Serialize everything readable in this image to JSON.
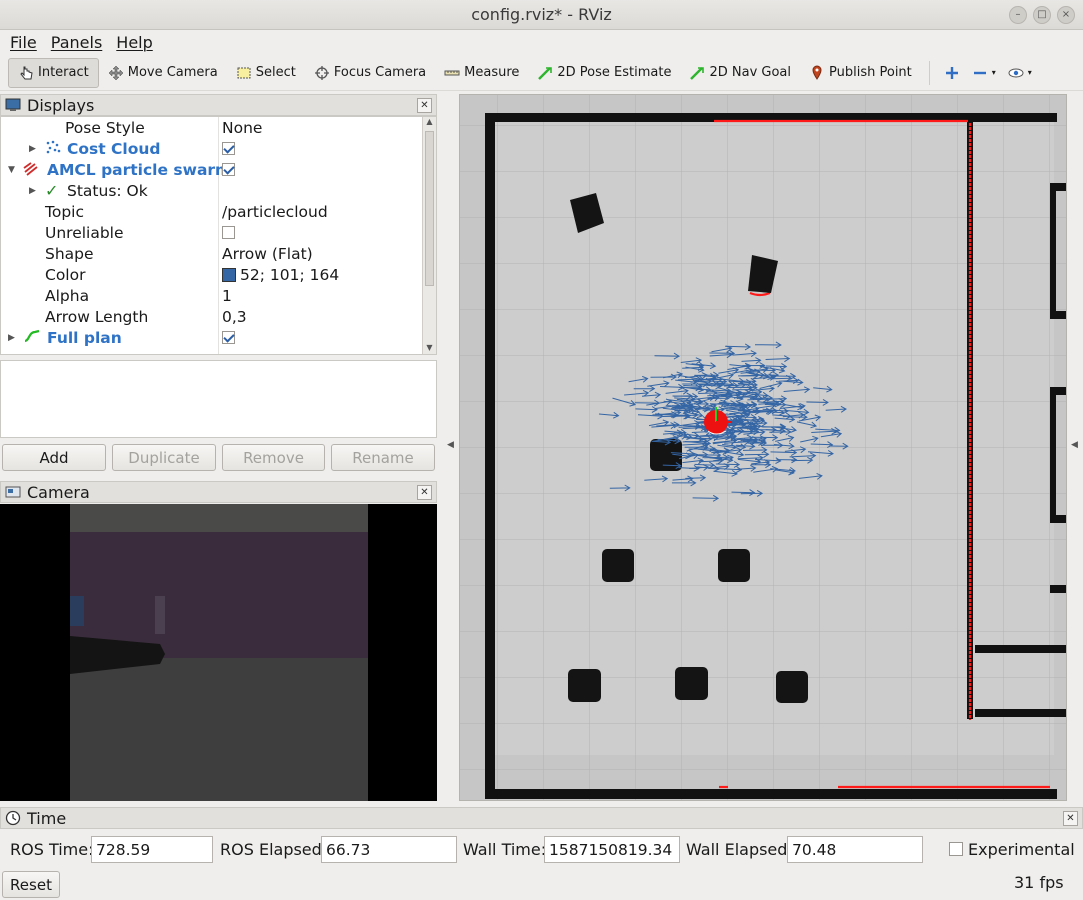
{
  "window": {
    "title": "config.rviz* - RViz"
  },
  "menu": {
    "file": "File",
    "panels": "Panels",
    "help": "Help"
  },
  "toolbar": {
    "interact": "Interact",
    "move_camera": "Move Camera",
    "select": "Select",
    "focus_camera": "Focus Camera",
    "measure": "Measure",
    "pose_estimate": "2D Pose Estimate",
    "nav_goal": "2D Nav Goal",
    "publish_point": "Publish Point"
  },
  "displays": {
    "title": "Displays",
    "rows": [
      {
        "key": "Pose Style",
        "value": "None"
      },
      {
        "key": "Cost Cloud",
        "value": ""
      },
      {
        "key": "AMCL particle swarm",
        "value": ""
      },
      {
        "key": "Status: Ok",
        "value": ""
      },
      {
        "key": "Topic",
        "value": "/particlecloud"
      },
      {
        "key": "Unreliable",
        "value": ""
      },
      {
        "key": "Shape",
        "value": "Arrow (Flat)"
      },
      {
        "key": "Color",
        "value": "52; 101; 164"
      },
      {
        "key": "Alpha",
        "value": "1"
      },
      {
        "key": "Arrow Length",
        "value": "0,3"
      },
      {
        "key": "Full plan",
        "value": ""
      }
    ],
    "buttons": {
      "add": "Add",
      "duplicate": "Duplicate",
      "remove": "Remove",
      "rename": "Rename"
    }
  },
  "camera": {
    "title": "Camera"
  },
  "time": {
    "title": "Time",
    "ros_time_label": "ROS Time:",
    "ros_time": "728.59",
    "ros_elapsed_label": "ROS Elapsed:",
    "ros_elapsed": "66.73",
    "wall_time_label": "Wall Time:",
    "wall_time": "1587150819.34",
    "wall_elapsed_label": "Wall Elapsed:",
    "wall_elapsed": "70.48",
    "experimental": "Experimental",
    "reset": "Reset",
    "fps": "31 fps"
  },
  "colors": {
    "particle": "#3465a4",
    "cost_cloud": "#2f73c6",
    "laser": "#ff0000",
    "full_plan": "#22bb22"
  }
}
